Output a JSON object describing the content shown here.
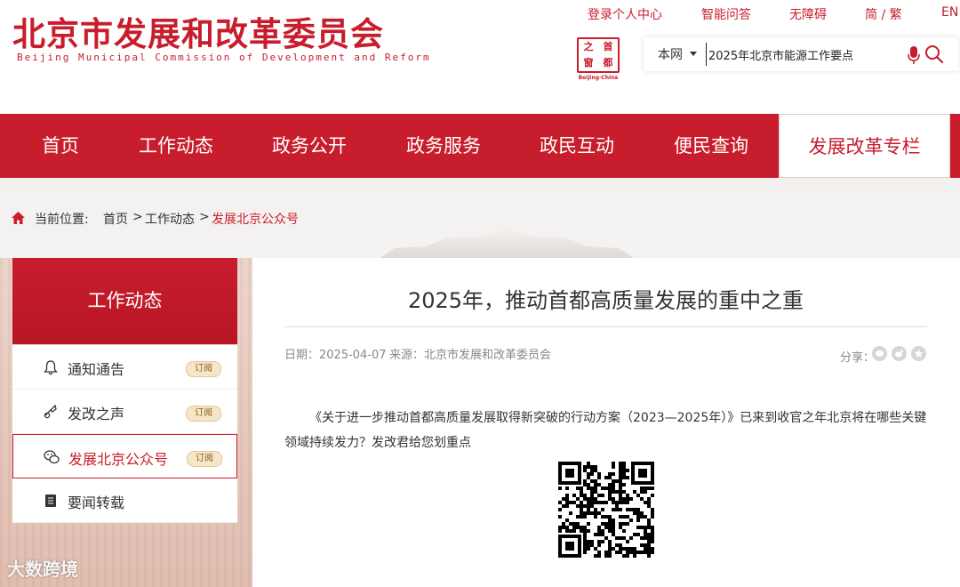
{
  "header": {
    "logo_cn": "北京市发展和改革委员会",
    "logo_en": "Beijing Municipal Commission of Development and Reform",
    "top_links": [
      "登录个人中心",
      "智能问答",
      "无障碍",
      "简 / 繁",
      "EN"
    ],
    "seal": {
      "chars": [
        "之",
        "首",
        "窗",
        "都"
      ],
      "caption": "Beijing·China"
    },
    "search": {
      "scope": "本网",
      "value": "2025年北京市能源工作要点"
    }
  },
  "nav": {
    "items": [
      "首页",
      "工作动态",
      "政务公开",
      "政务服务",
      "政民互动",
      "便民查询",
      "发展改革专栏"
    ],
    "active": "发展改革专栏"
  },
  "breadcrumb": {
    "label": "当前位置:",
    "items": [
      "首页",
      ">",
      "工作动态",
      ">",
      "发展北京公众号"
    ]
  },
  "sidebar": {
    "title": "工作动态",
    "subscribe_label": "订阅",
    "items": [
      {
        "label": "通知通告",
        "icon": "bell-icon"
      },
      {
        "label": "发改之声",
        "icon": "trumpet-icon"
      },
      {
        "label": "发展北京公众号",
        "icon": "wechat-icon"
      },
      {
        "label": "要闻转载",
        "icon": "book-icon"
      }
    ],
    "active": "发展北京公众号"
  },
  "article": {
    "title": "2025年，推动首都高质量发展的重中之重",
    "date": "日期：2025-04-07",
    "source": "来源：北京市发展和改革委员会",
    "share_label": "分享：",
    "share_icons": [
      "wechat-icon",
      "weibo-icon",
      "star-icon"
    ],
    "body": "《关于进一步推动首都高质量发展取得新突破的行动方案（2023—2025年）》已来到收官之年北京将在哪些关键领域持续发力？发改君给您划重点"
  },
  "watermark": "大数跨境",
  "colors": {
    "brand_red": "#c81d2c",
    "subscribe_bg": "#f5e6c8",
    "text": "#333333",
    "muted": "#888888"
  }
}
